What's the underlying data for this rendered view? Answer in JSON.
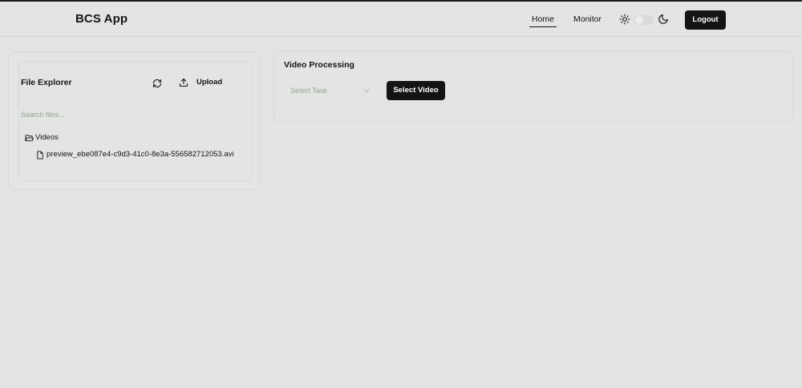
{
  "header": {
    "brand": "BCS App",
    "nav": [
      {
        "label": "Home",
        "active": true
      },
      {
        "label": "Monitor",
        "active": false
      }
    ],
    "theme_icons": [
      "sun-icon",
      "moon-icon"
    ],
    "logout_label": "Logout"
  },
  "file_explorer": {
    "title": "File Explorer",
    "refresh_icon": "refresh-icon",
    "upload_label": "Upload",
    "search_placeholder": "Search files...",
    "folder": {
      "icon": "folder-open-icon",
      "name": "Videos",
      "files": [
        {
          "icon": "file-icon",
          "name": "preview_ebe087e4-c9d3-41c0-8e3a-556582712053.avi"
        }
      ]
    }
  },
  "video_processing": {
    "title": "Video Processing",
    "task_placeholder": "Select Task",
    "select_video_label": "Select Video"
  },
  "colors": {
    "background": "#e2e5e1",
    "primary": "#141414",
    "muted_text": "#9aa09a"
  }
}
